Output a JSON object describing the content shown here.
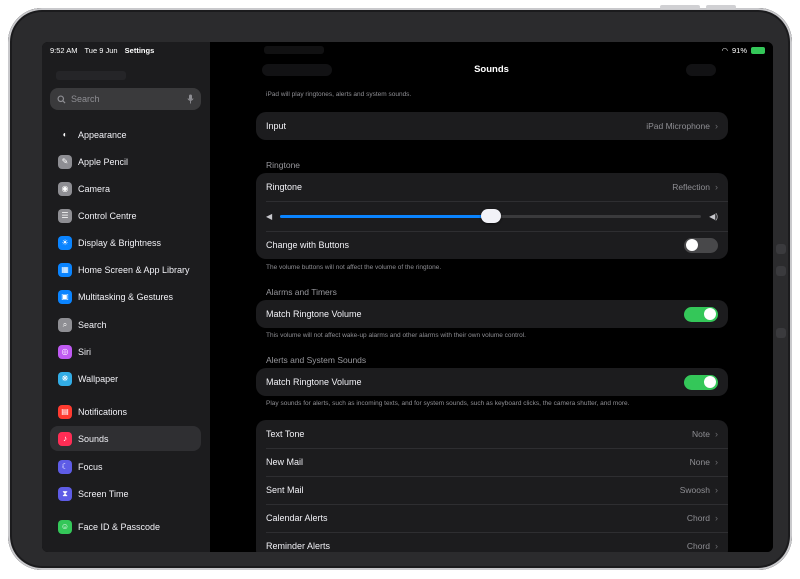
{
  "status": {
    "time": "9:52 AM",
    "date": "Tue 9 Jun",
    "app": "Settings",
    "battery": "91%"
  },
  "sidebar": {
    "search": {
      "placeholder": "Search"
    },
    "items": [
      {
        "label": "Appearance",
        "color": "#1c1c1e",
        "glyph": "◐",
        "icon": "appearance-icon"
      },
      {
        "label": "Apple Pencil",
        "color": "#8e8e93",
        "glyph": "✎",
        "icon": "pencil-icon"
      },
      {
        "label": "Camera",
        "color": "#8e8e93",
        "glyph": "◉",
        "icon": "camera-icon"
      },
      {
        "label": "Control Centre",
        "color": "#8e8e93",
        "glyph": "☰",
        "icon": "control-centre-icon"
      },
      {
        "label": "Display & Brightness",
        "color": "#0a84ff",
        "glyph": "☀",
        "icon": "brightness-icon"
      },
      {
        "label": "Home Screen & App Library",
        "color": "#0a84ff",
        "glyph": "▦",
        "icon": "home-screen-icon"
      },
      {
        "label": "Multitasking & Gestures",
        "color": "#0a84ff",
        "glyph": "▣",
        "icon": "multitasking-icon"
      },
      {
        "label": "Search",
        "color": "#8e8e93",
        "glyph": "⌕",
        "icon": "search-settings-icon"
      },
      {
        "label": "Siri",
        "color": "#bf5af2",
        "glyph": "◎",
        "icon": "siri-icon"
      },
      {
        "label": "Wallpaper",
        "color": "#32ade6",
        "glyph": "❋",
        "icon": "wallpaper-icon"
      },
      {
        "label": "Notifications",
        "color": "#ff3b30",
        "glyph": "▤",
        "icon": "notifications-icon"
      },
      {
        "label": "Sounds",
        "color": "#ff2d55",
        "glyph": "♪",
        "icon": "sounds-icon"
      },
      {
        "label": "Focus",
        "color": "#5e5ce6",
        "glyph": "☾",
        "icon": "focus-icon"
      },
      {
        "label": "Screen Time",
        "color": "#5e5ce6",
        "glyph": "⧗",
        "icon": "screen-time-icon"
      },
      {
        "label": "Face ID & Passcode",
        "color": "#34c759",
        "glyph": "☺",
        "icon": "face-id-icon"
      }
    ]
  },
  "main": {
    "title": "Sounds",
    "top_note": "iPad will play ringtones, alerts and system sounds.",
    "input": {
      "label": "Input",
      "value": "iPad Microphone"
    },
    "ringtone_section": {
      "header": "Ringtone",
      "ringtone": {
        "label": "Ringtone",
        "value": "Reflection"
      },
      "volume_level": 0.5,
      "change_with_buttons": {
        "label": "Change with Buttons",
        "on": false
      },
      "footnote": "The volume buttons will not affect the volume of the ringtone."
    },
    "alarms_section": {
      "header": "Alarms and Timers",
      "match": {
        "label": "Match Ringtone Volume",
        "on": true
      },
      "footnote": "This volume will not affect wake-up alarms and other alarms with their own volume control."
    },
    "alerts_section": {
      "header": "Alerts and System Sounds",
      "match": {
        "label": "Match Ringtone Volume",
        "on": true
      },
      "footnote": "Play sounds for alerts, such as incoming texts, and for system sounds, such as keyboard clicks, the camera shutter, and more."
    },
    "tones": [
      {
        "label": "Text Tone",
        "value": "Note"
      },
      {
        "label": "New Mail",
        "value": "None"
      },
      {
        "label": "Sent Mail",
        "value": "Swoosh"
      },
      {
        "label": "Calendar Alerts",
        "value": "Chord"
      },
      {
        "label": "Reminder Alerts",
        "value": "Chord"
      }
    ]
  },
  "colors": {
    "accent": "#0a84ff",
    "toggle_on": "#34c759"
  }
}
